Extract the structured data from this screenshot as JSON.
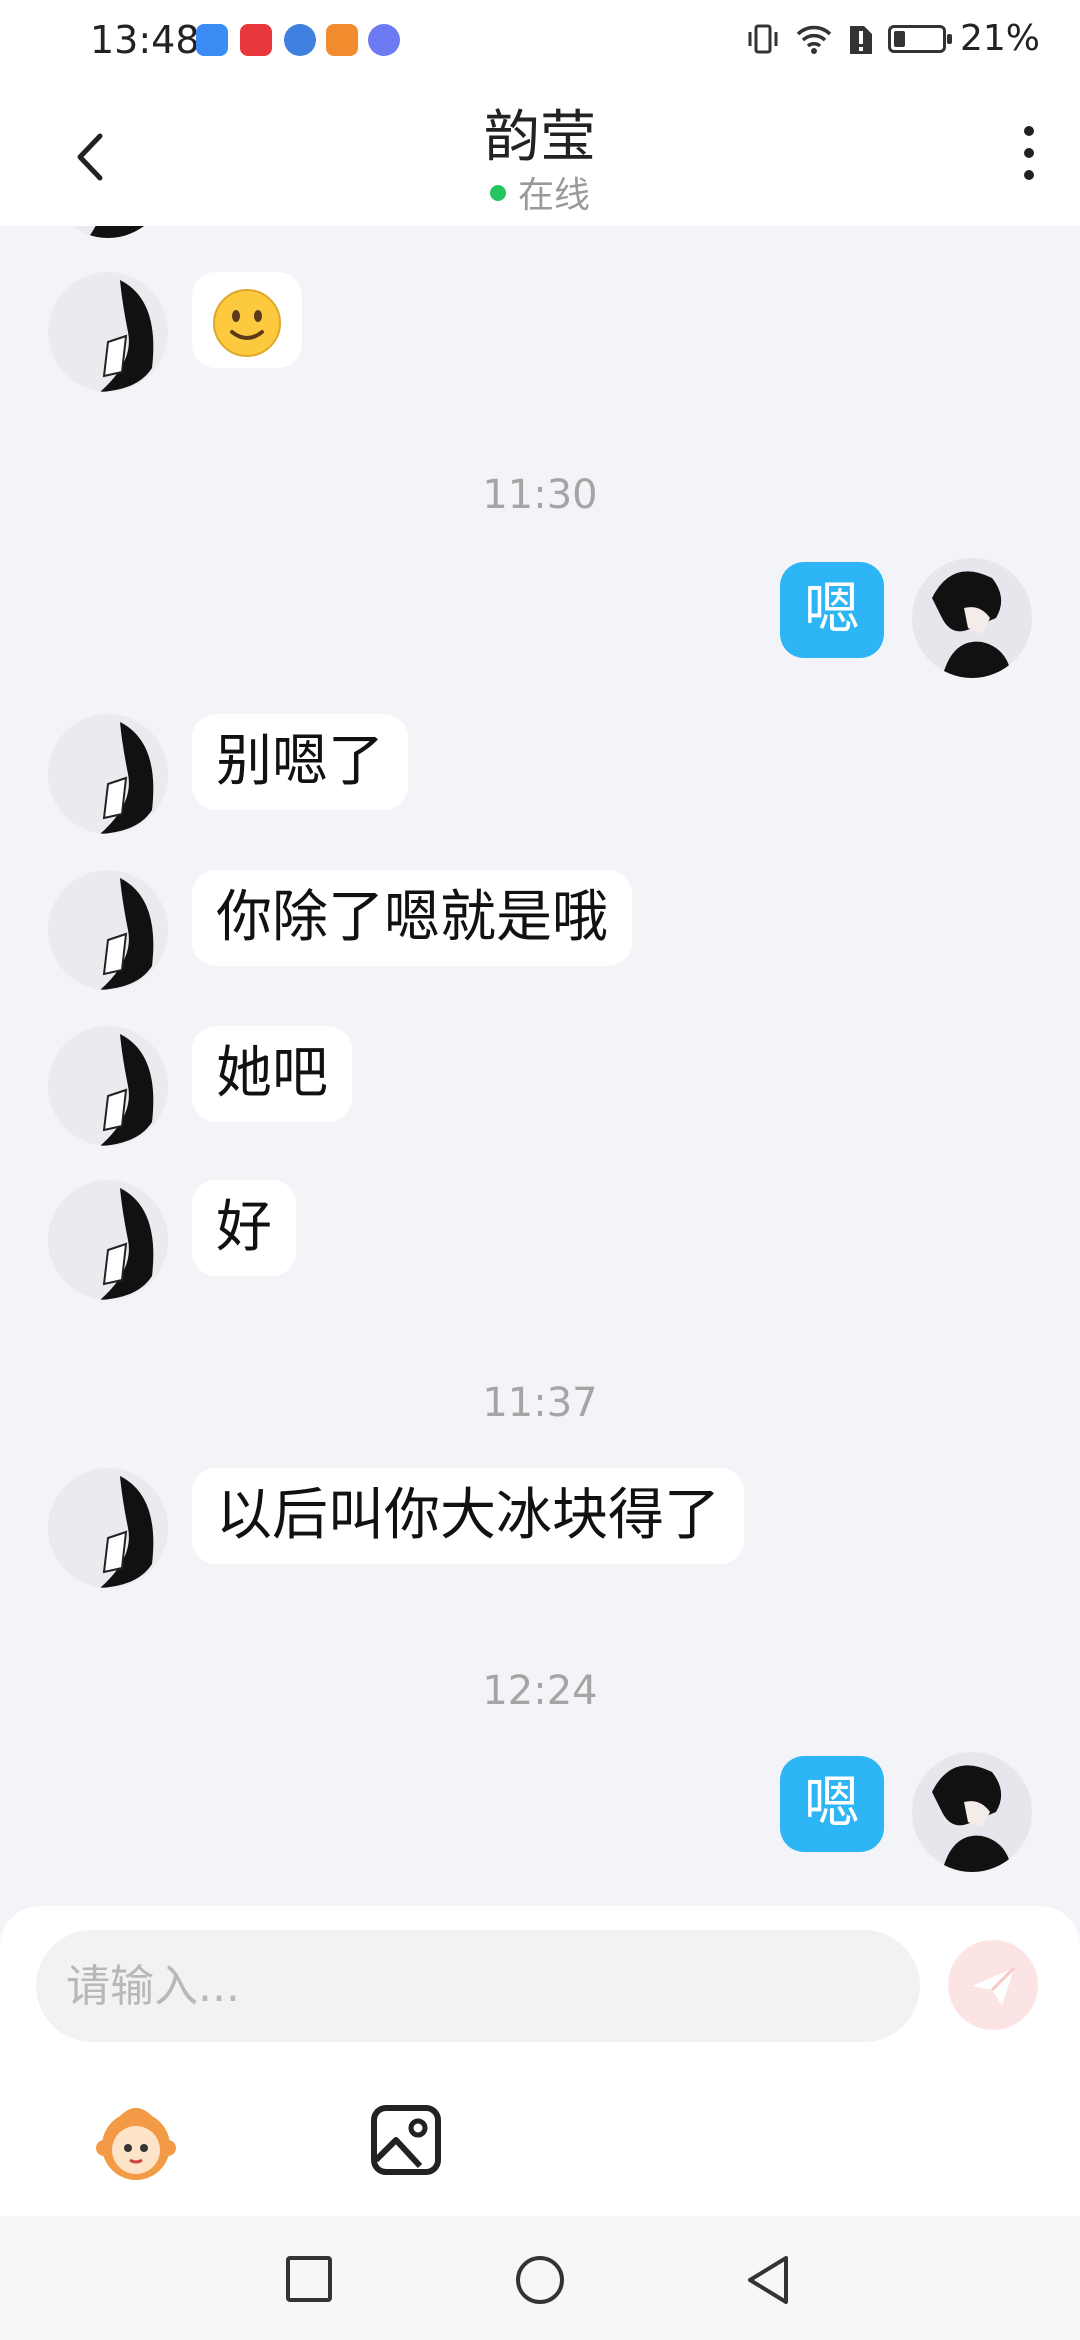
{
  "status_bar": {
    "time": "13:48",
    "battery_text": "21%",
    "battery_level": 0.21
  },
  "header": {
    "title": "韵莹",
    "status": "在线"
  },
  "messages": [
    {
      "type": "received",
      "emoji": "slightly-smiling-face"
    },
    {
      "type": "timestamp",
      "text": "11:30"
    },
    {
      "type": "sent",
      "text": "嗯"
    },
    {
      "type": "received",
      "text": "别嗯了"
    },
    {
      "type": "received",
      "text": "你除了嗯就是哦"
    },
    {
      "type": "received",
      "text": "她吧"
    },
    {
      "type": "received",
      "text": "好"
    },
    {
      "type": "timestamp",
      "text": "11:37"
    },
    {
      "type": "received",
      "text": "以后叫你大冰块得了"
    },
    {
      "type": "timestamp",
      "text": "12:24"
    },
    {
      "type": "sent",
      "text": "嗯"
    }
  ],
  "input": {
    "placeholder": "请输入...",
    "value": ""
  },
  "colors": {
    "sent_bubble": "#2eb5f6",
    "online_dot": "#22c55e",
    "send_button": "#fde4e4"
  },
  "icons": [
    "back-arrow-icon",
    "more-vertical-icon",
    "mascot-sticker-icon",
    "image-icon",
    "send-icon",
    "square-nav-icon",
    "circle-nav-icon",
    "triangle-back-nav-icon"
  ]
}
